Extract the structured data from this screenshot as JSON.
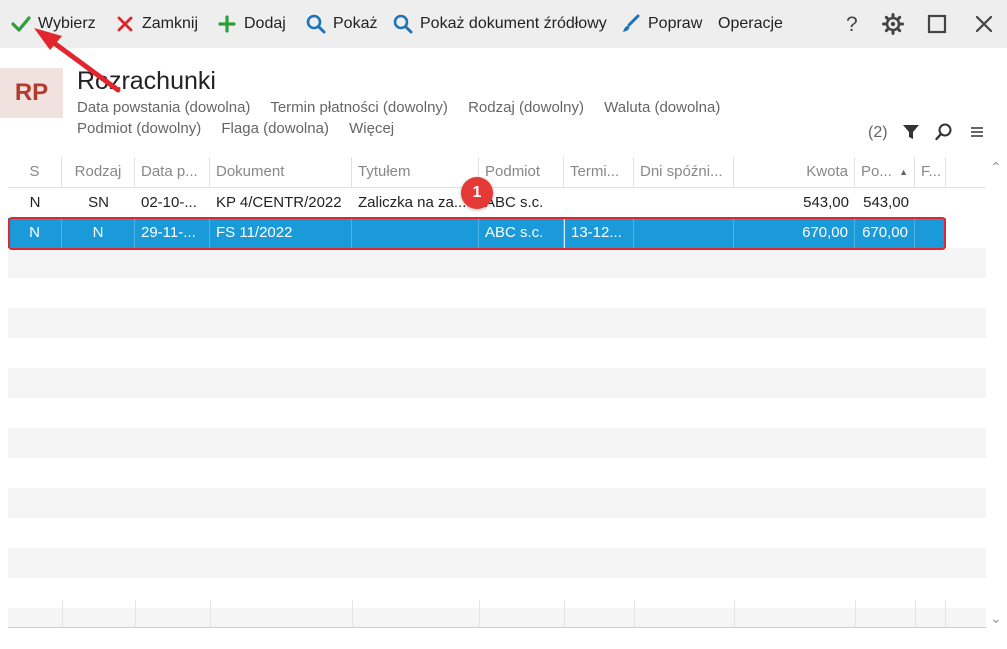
{
  "toolbar": {
    "select_label": "Wybierz",
    "close_label": "Zamknij",
    "add_label": "Dodaj",
    "show_label": "Pokaż",
    "show_source_label": "Pokaż dokument źródłowy",
    "edit_label": "Popraw",
    "operations_label": "Operacje"
  },
  "header": {
    "logo": "RP",
    "title": "Rozrachunki",
    "filters": [
      "Data powstania (dowolna)",
      "Termin płatności (dowolny)",
      "Rodzaj (dowolny)",
      "Waluta (dowolna)",
      "Podmiot (dowolny)",
      "Flaga (dowolna)",
      "Więcej"
    ],
    "count": "(2)"
  },
  "table": {
    "columns": [
      "S",
      "Rodzaj",
      "Data p...",
      "Dokument",
      "Tytułem",
      "Podmiot",
      "Termi...",
      "Dni spóźni...",
      "Kwota",
      "Po...",
      "F..."
    ],
    "rows": [
      [
        "N",
        "SN",
        "02-10-...",
        "KP 4/CENTR/2022",
        "Zaliczka na za...",
        "ABC s.c.",
        "",
        "",
        "543,00",
        "543,00",
        ""
      ],
      [
        "N",
        "N",
        "29-11-...",
        "FS 11/2022",
        "",
        "ABC s.c.",
        "13-12...",
        "",
        "670,00",
        "670,00",
        ""
      ]
    ]
  },
  "annotation": {
    "badge": "1"
  },
  "colors": {
    "selection": "#1a9ad9",
    "highlight": "#e2262d",
    "accent_green": "#2e9e3a",
    "accent_red": "#d9262c",
    "accent_blue": "#1d74b8"
  },
  "icons": [
    "check-icon",
    "close-x-icon",
    "plus-icon",
    "search-icon",
    "search-doc-icon",
    "brush-icon",
    "help-icon",
    "gear-icon",
    "maximize-icon",
    "window-close-icon",
    "filter-icon",
    "search-small-icon",
    "menu-icon"
  ]
}
